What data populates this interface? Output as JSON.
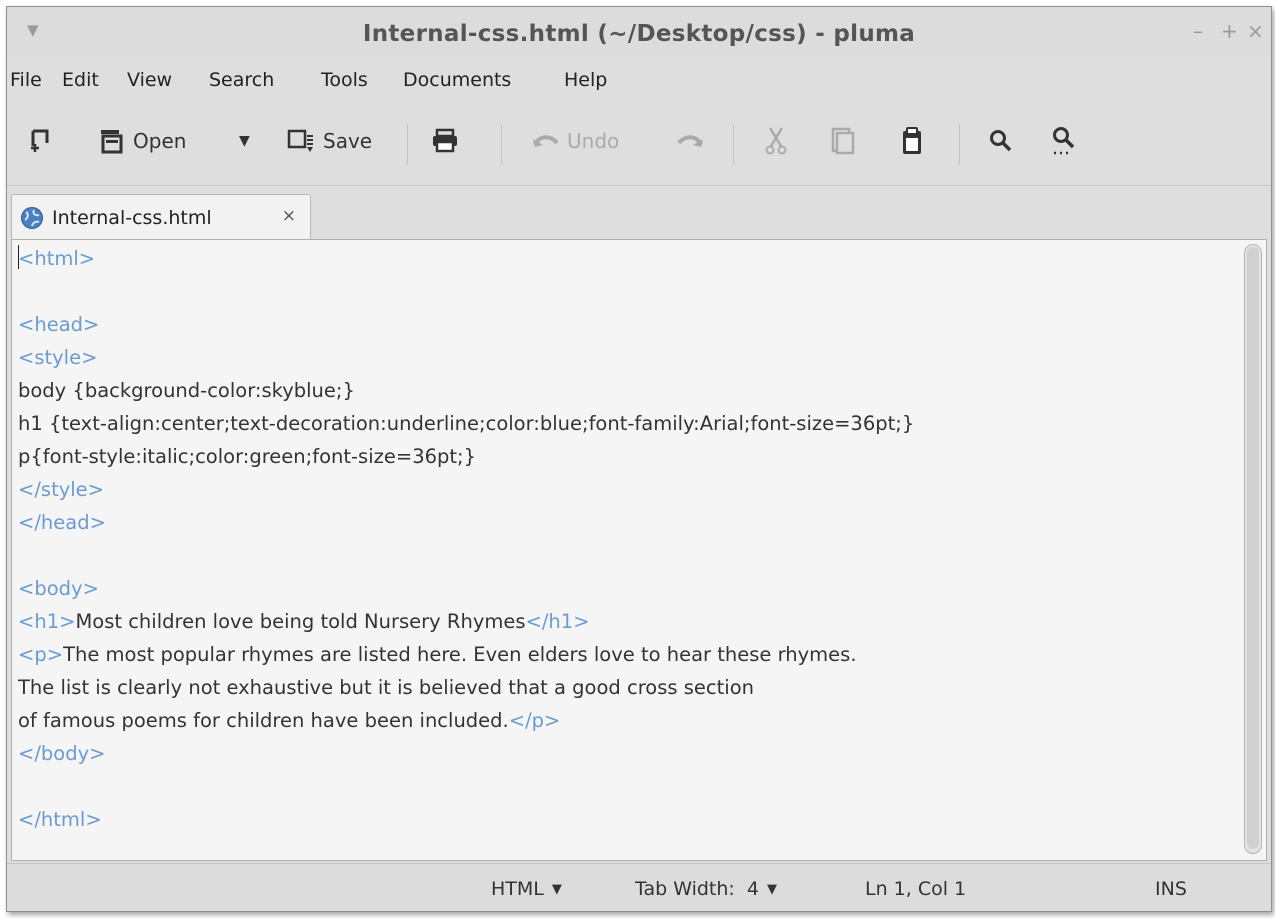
{
  "window": {
    "title": "Internal-css.html (~/Desktop/css) - pluma",
    "controls": {
      "minimize": "–",
      "maximize": "+",
      "close": "×"
    }
  },
  "menubar": [
    "File",
    "Edit",
    "View",
    "Search",
    "Tools",
    "Documents",
    "Help"
  ],
  "toolbar": {
    "new_icon": "new-document-icon",
    "open_label": "Open",
    "save_label": "Save",
    "undo_label": "Undo",
    "print_icon": "printer-icon",
    "redo_icon": "redo-icon",
    "cut_icon": "scissors-icon",
    "copy_icon": "copy-icon",
    "paste_icon": "clipboard-icon",
    "find_icon": "search-icon",
    "replace_icon": "search-replace-icon"
  },
  "tab": {
    "label": "Internal-css.html",
    "close": "×"
  },
  "editor": {
    "lines": [
      [
        {
          "t": "<html>",
          "tag": true
        }
      ],
      [],
      [
        {
          "t": "<head>",
          "tag": true
        }
      ],
      [
        {
          "t": "<style>",
          "tag": true
        }
      ],
      [
        {
          "t": "body {background-color:skyblue;}",
          "tag": false
        }
      ],
      [
        {
          "t": "h1 {text-align:center;text-decoration:underline;color:blue;font-family:Arial;font-size=36pt;}",
          "tag": false
        }
      ],
      [
        {
          "t": "p{font-style:italic;color:green;font-size=36pt;}",
          "tag": false
        }
      ],
      [
        {
          "t": "</style>",
          "tag": true
        }
      ],
      [
        {
          "t": "</head>",
          "tag": true
        }
      ],
      [],
      [
        {
          "t": "<body>",
          "tag": true
        }
      ],
      [
        {
          "t": "<h1>",
          "tag": true
        },
        {
          "t": "Most children love being told Nursery Rhymes",
          "tag": false
        },
        {
          "t": "</h1>",
          "tag": true
        }
      ],
      [
        {
          "t": "<p>",
          "tag": true
        },
        {
          "t": "The most popular rhymes are listed here. Even elders love to hear these rhymes.",
          "tag": false
        }
      ],
      [
        {
          "t": "The list is clearly not exhaustive but it is believed that a good cross section",
          "tag": false
        }
      ],
      [
        {
          "t": "of famous poems for children have been included.",
          "tag": false
        },
        {
          "t": "</p>",
          "tag": true
        }
      ],
      [
        {
          "t": "</body>",
          "tag": true
        }
      ],
      [],
      [
        {
          "t": "</html>",
          "tag": true
        }
      ]
    ]
  },
  "statusbar": {
    "language": "HTML",
    "tab_width": "Tab Width:  4",
    "position": "Ln 1, Col 1",
    "mode": "INS"
  },
  "colors": {
    "tag": "#6a9bd1",
    "text": "#333333",
    "editor_bg": "#f5f5f5",
    "chrome": "#dcdcdc"
  }
}
